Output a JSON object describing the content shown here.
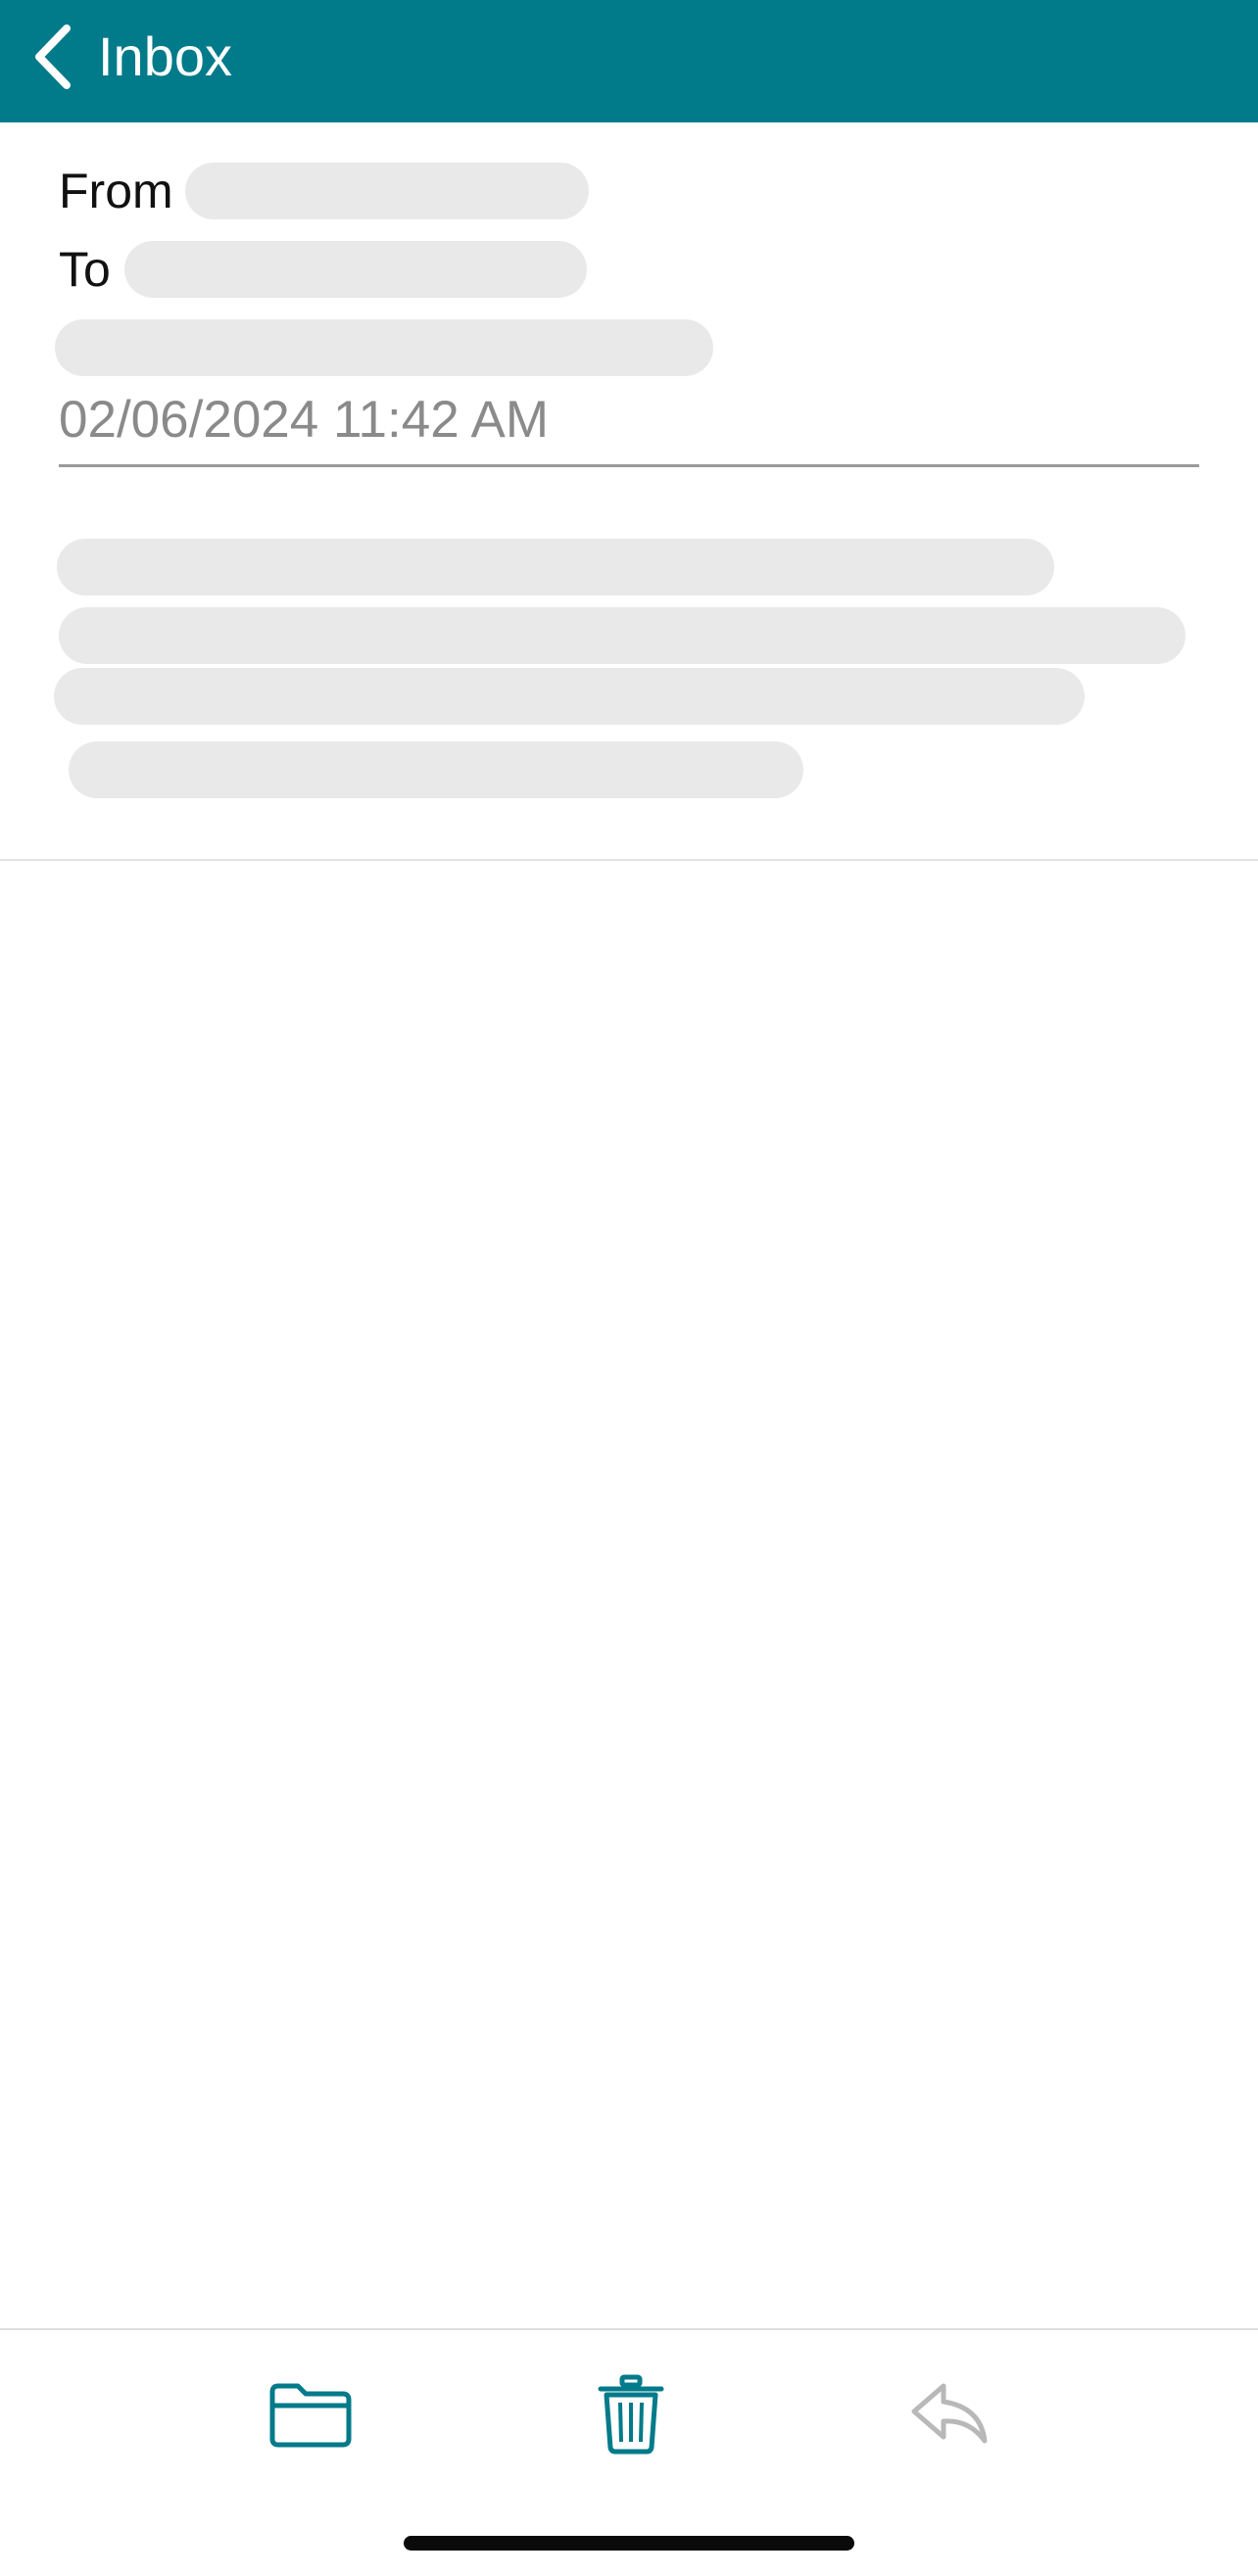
{
  "header": {
    "back_label": "Inbox",
    "background_color": "#017a8a"
  },
  "message": {
    "from_label": "From",
    "to_label": "To",
    "date": "02/06/2024 11:42 AM"
  },
  "toolbar": {
    "icons": [
      "folder-icon",
      "trash-icon",
      "reply-icon"
    ],
    "accent_color": "#017a8a",
    "disabled_color": "#b8b8b8"
  }
}
